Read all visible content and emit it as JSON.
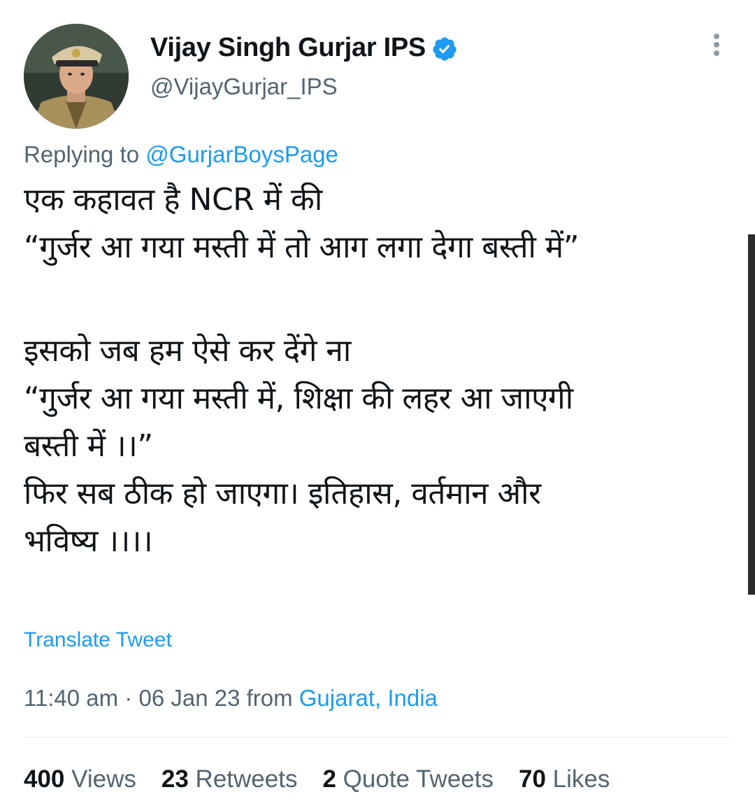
{
  "author": {
    "name": "Vijay Singh Gurjar IPS",
    "handle": "@VijayGurjar_IPS",
    "verified_icon": "verified-badge-icon",
    "verified_color": "#1d9bf0"
  },
  "reply": {
    "prefix": "Replying to",
    "mention": "@GurjarBoysPage"
  },
  "body": {
    "lines": [
      "एक कहावत है NCR में की",
      "“गुर्जर आ गया मस्ती में तो आग लगा देगा बस्ती में”",
      "",
      "इसको जब हम ऐसे कर देंगे ना",
      "“गुर्जर आ गया मस्ती में, शिक्षा की लहर आ जाएगी",
      "बस्ती में ।।”",
      "फिर सब ठीक हो जाएगा। इतिहास, वर्तमान और",
      "भविष्य ।।।।"
    ]
  },
  "translate_label": "Translate Tweet",
  "meta": {
    "time_date": "11:40 am · 06 Jan 23 from",
    "location": "Gujarat, India"
  },
  "stats": [
    {
      "count": "400",
      "label": "Views"
    },
    {
      "count": "23",
      "label": "Retweets"
    },
    {
      "count": "2",
      "label": "Quote Tweets"
    },
    {
      "count": "70",
      "label": "Likes"
    }
  ],
  "colors": {
    "text": "#0f1419",
    "secondary": "#536471",
    "link": "#1d9bf0"
  },
  "icons": {
    "more": "more-vertical-icon",
    "avatar": "avatar-image"
  }
}
